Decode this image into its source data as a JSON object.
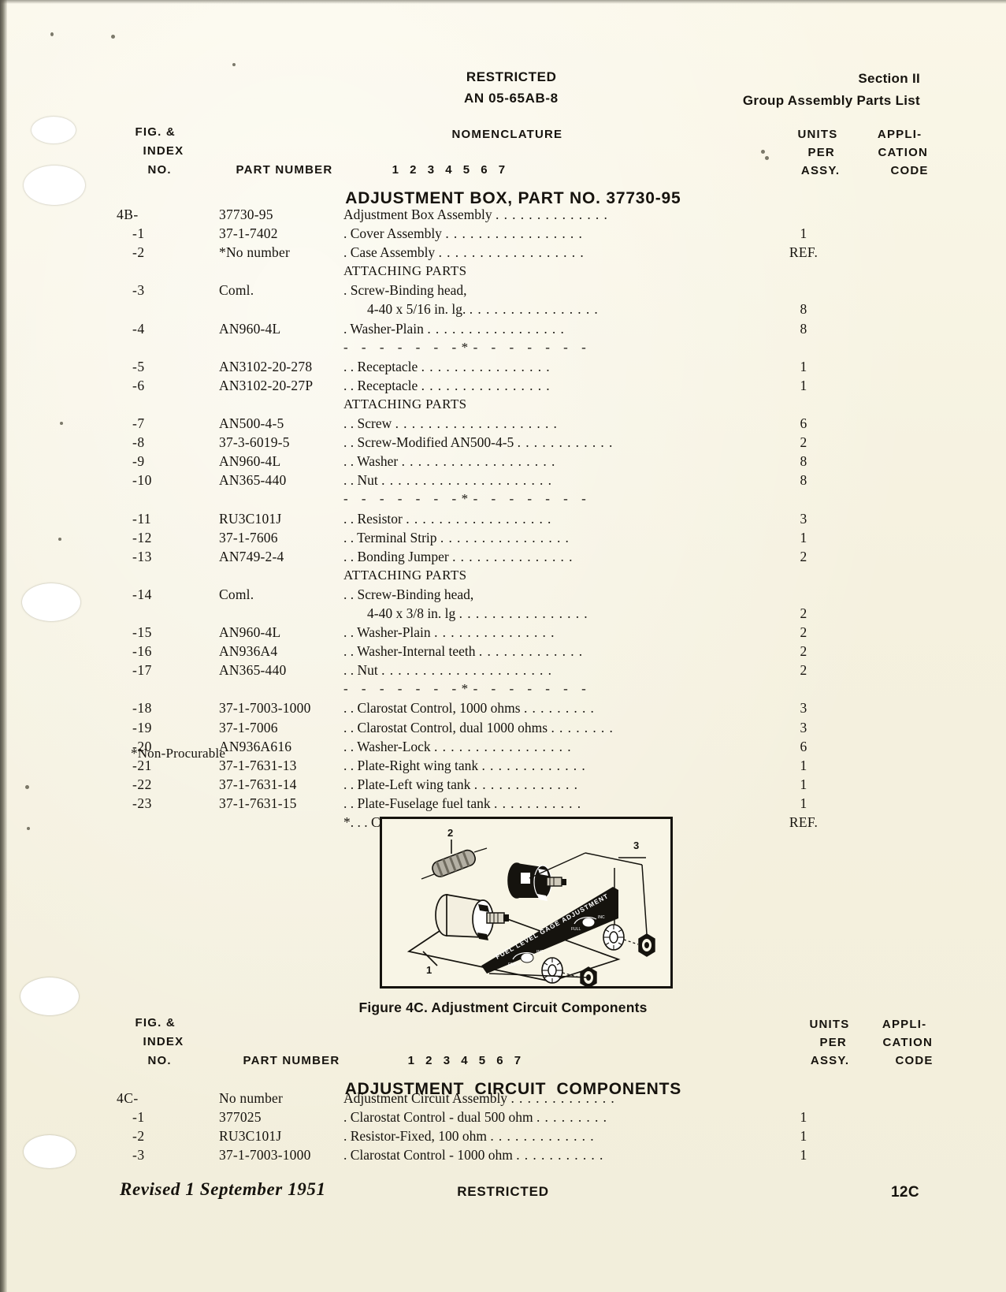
{
  "header": {
    "classification": "RESTRICTED",
    "manual_no": "AN 05-65AB-8",
    "section": "Section II",
    "section_subtitle": "Group Assembly Parts List"
  },
  "column_headers": {
    "fig_index_line1": "FIG. &",
    "fig_index_line2": "INDEX",
    "fig_index_line3": "NO.",
    "part_number": "PART NUMBER",
    "nomenclature": "NOMENCLATURE",
    "nomenclature_levels": "1 2 3 4 5 6 7",
    "units_line1": "UNITS",
    "units_line2": "PER",
    "units_line3": "ASSY.",
    "appl_line1": "APPLI-",
    "appl_line2": "CATION",
    "appl_line3": "CODE"
  },
  "table1": {
    "title": "ADJUSTMENT BOX, PART NO. 37730-95",
    "attaching_parts_label": "ATTACHING PARTS",
    "separator": "- - - - - - -*- - - - - - -",
    "rows": [
      {
        "kind": "item",
        "index": "4B-",
        "indent": false,
        "part": "37730-95",
        "nom": "Adjustment Box Assembly",
        "dots": 14,
        "units": ""
      },
      {
        "kind": "item",
        "index": "-1",
        "indent": true,
        "part": "37-1-7402",
        "nom": ". Cover Assembly",
        "dots": 17,
        "units": "1"
      },
      {
        "kind": "item",
        "index": "-2",
        "indent": true,
        "part": "*No number",
        "nom": ". Case Assembly",
        "dots": 18,
        "units": "REF."
      },
      {
        "kind": "attaching"
      },
      {
        "kind": "item",
        "index": "-3",
        "indent": true,
        "part": "Coml.",
        "nom": ". Screw-Binding head,",
        "dots": 0,
        "units": ""
      },
      {
        "kind": "cont",
        "nom": "4-40 x 5/16 in. lg.",
        "dots": 16,
        "units": "8"
      },
      {
        "kind": "item",
        "index": "-4",
        "indent": true,
        "part": "AN960-4L",
        "nom": ". Washer-Plain",
        "dots": 17,
        "units": "8"
      },
      {
        "kind": "sep"
      },
      {
        "kind": "item",
        "index": "-5",
        "indent": true,
        "part": "AN3102-20-278",
        "nom": ". . Receptacle",
        "dots": 16,
        "units": "1"
      },
      {
        "kind": "item",
        "index": "-6",
        "indent": true,
        "part": "AN3102-20-27P",
        "nom": ". . Receptacle",
        "dots": 16,
        "units": "1"
      },
      {
        "kind": "attaching"
      },
      {
        "kind": "item",
        "index": "-7",
        "indent": true,
        "part": "AN500-4-5",
        "nom": ". . Screw",
        "dots": 20,
        "units": "6"
      },
      {
        "kind": "item",
        "index": "-8",
        "indent": true,
        "part": "37-3-6019-5",
        "nom": ". . Screw-Modified AN500-4-5",
        "dots": 12,
        "units": "2"
      },
      {
        "kind": "item",
        "index": "-9",
        "indent": true,
        "part": "AN960-4L",
        "nom": ". . Washer",
        "dots": 19,
        "units": "8"
      },
      {
        "kind": "item",
        "index": "-10",
        "indent": true,
        "part": "AN365-440",
        "nom": ". . Nut",
        "dots": 21,
        "units": "8"
      },
      {
        "kind": "sep"
      },
      {
        "kind": "item",
        "index": "-11",
        "indent": true,
        "part": "RU3C101J",
        "nom": ". . Resistor",
        "dots": 18,
        "units": "3"
      },
      {
        "kind": "item",
        "index": "-12",
        "indent": true,
        "part": "37-1-7606",
        "nom": ". . Terminal Strip",
        "dots": 16,
        "units": "1"
      },
      {
        "kind": "item",
        "index": "-13",
        "indent": true,
        "part": "AN749-2-4",
        "nom": ". . Bonding Jumper",
        "dots": 15,
        "units": "2"
      },
      {
        "kind": "attaching"
      },
      {
        "kind": "item",
        "index": "-14",
        "indent": true,
        "part": "Coml.",
        "nom": ". . Screw-Binding head,",
        "dots": 0,
        "units": ""
      },
      {
        "kind": "cont",
        "nom": "4-40 x 3/8 in. lg",
        "dots": 16,
        "units": "2"
      },
      {
        "kind": "item",
        "index": "-15",
        "indent": true,
        "part": "AN960-4L",
        "nom": ". . Washer-Plain",
        "dots": 15,
        "units": "2"
      },
      {
        "kind": "item",
        "index": "-16",
        "indent": true,
        "part": "AN936A4",
        "nom": ". . Washer-Internal teeth",
        "dots": 13,
        "units": "2"
      },
      {
        "kind": "item",
        "index": "-17",
        "indent": true,
        "part": "AN365-440",
        "nom": ". . Nut",
        "dots": 21,
        "units": "2"
      },
      {
        "kind": "sep"
      },
      {
        "kind": "item",
        "index": "-18",
        "indent": true,
        "part": "37-1-7003-1000",
        "nom": ". . Clarostat Control,  1000 ohms",
        "dots": 9,
        "units": "3"
      },
      {
        "kind": "item",
        "index": "-19",
        "indent": true,
        "part": "37-1-7006",
        "nom": ". . Clarostat Control, dual 1000 ohms",
        "dots": 8,
        "units": "3"
      },
      {
        "kind": "item",
        "index": "-20",
        "indent": true,
        "part": "AN936A616",
        "nom": ". . Washer-Lock",
        "dots": 17,
        "units": "6"
      },
      {
        "kind": "item",
        "index": "-21",
        "indent": true,
        "part": "37-1-7631-13",
        "nom": ". . Plate-Right wing tank",
        "dots": 13,
        "units": "1"
      },
      {
        "kind": "item",
        "index": "-22",
        "indent": true,
        "part": "37-1-7631-14",
        "nom": ". . Plate-Left wing tank",
        "dots": 13,
        "units": "1"
      },
      {
        "kind": "item",
        "index": "-23",
        "indent": true,
        "part": "37-1-7631-15",
        "nom": ". . Plate-Fuselage fuel tank",
        "dots": 11,
        "units": "1"
      },
      {
        "kind": "item",
        "index": "",
        "indent": true,
        "part": "",
        "nom": "*. . . Case Sub-Assembly",
        "dots": 13,
        "units": "REF."
      }
    ],
    "footnote": "*Non-Procurable"
  },
  "figure": {
    "caption": "Figure 4C.  Adjustment Circuit Components",
    "callouts": [
      "1",
      "2",
      "3"
    ],
    "panel_text": "FUEL LEVEL GAGE ADJUSTMENT",
    "dial_labels": [
      "EMPTY",
      "FULL",
      "INC",
      "INC"
    ]
  },
  "table2": {
    "title": "ADJUSTMENT  CIRCUIT  COMPONENTS",
    "rows": [
      {
        "kind": "item",
        "index": "4C-",
        "indent": false,
        "part": "No number",
        "nom": "Adjustment Circuit Assembly",
        "dots": 13,
        "units": ""
      },
      {
        "kind": "item",
        "index": "-1",
        "indent": true,
        "part": "377025",
        "nom": ". Clarostat Control - dual 500 ohm",
        "dots": 9,
        "units": "1"
      },
      {
        "kind": "item",
        "index": "-2",
        "indent": true,
        "part": "RU3C101J",
        "nom": ". Resistor-Fixed, 100 ohm",
        "dots": 13,
        "units": "1"
      },
      {
        "kind": "item",
        "index": "-3",
        "indent": true,
        "part": "37-1-7003-1000",
        "nom": ". Clarostat Control - 1000 ohm",
        "dots": 11,
        "units": "1"
      }
    ]
  },
  "footer": {
    "revision": "Revised 1 September 1951",
    "classification": "RESTRICTED",
    "page": "12C"
  }
}
